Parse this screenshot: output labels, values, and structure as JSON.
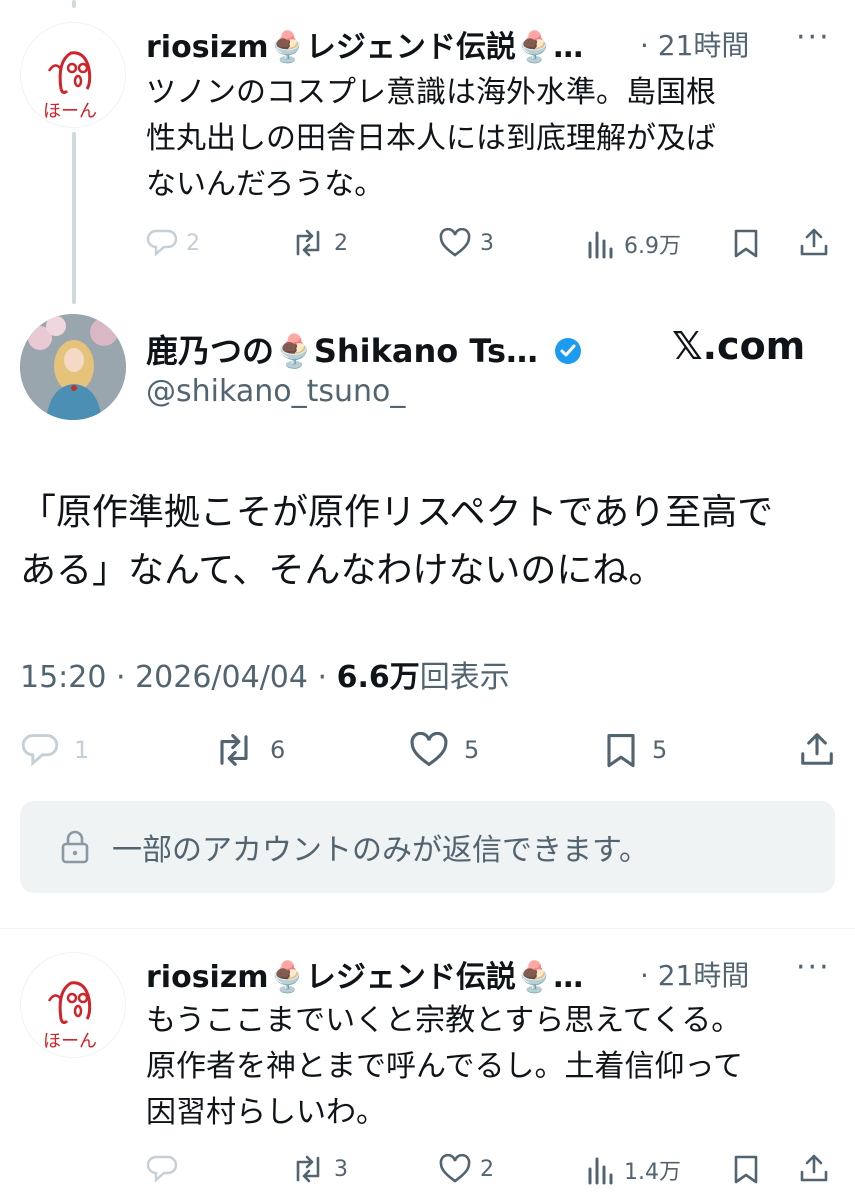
{
  "reply1": {
    "name": "riosizm🍨レジェンド伝説🍨…",
    "time": "· 21時間",
    "more": "···",
    "avatar_text": "ほーん",
    "text_lines": [
      "ツノンのコスプレ意識は海外水準。島国根",
      "性丸出しの田舎日本人には到底理解が及ば",
      "ないんだろうな。"
    ],
    "replies": "2",
    "reposts": "2",
    "likes": "3",
    "views": "6.9万"
  },
  "main": {
    "name": "鹿乃つの🍨Shikano Ts…",
    "handle": "@shikano_tsuno_",
    "watermark": "𝕏.com",
    "text_lines": [
      "「原作準拠こそが原作リスペクトであり至高で",
      "ある」なんて、そんなわけないのにね。"
    ],
    "time": "15:20 · 2026/04/04 · ",
    "views_count": "6.6万",
    "views_label": "回表示",
    "replies": "1",
    "reposts": "6",
    "likes": "5",
    "bookmarks": "5",
    "restricted_notice": "一部のアカウントのみが返信できます。"
  },
  "reply2": {
    "name": "riosizm🍨レジェンド伝説🍨…",
    "time": "· 21時間",
    "more": "···",
    "avatar_text": "ほーん",
    "text_lines": [
      "もうここまでいくと宗教とすら思えてくる。",
      "原作者を神とまで呼んでるし。土着信仰って",
      "因習村らしいわ。"
    ],
    "replies": "",
    "reposts": "3",
    "likes": "2",
    "views": "1.4万"
  },
  "colors": {
    "verified": "#1d9bf0",
    "muted": "#536471",
    "stamp": "#d2232a"
  }
}
